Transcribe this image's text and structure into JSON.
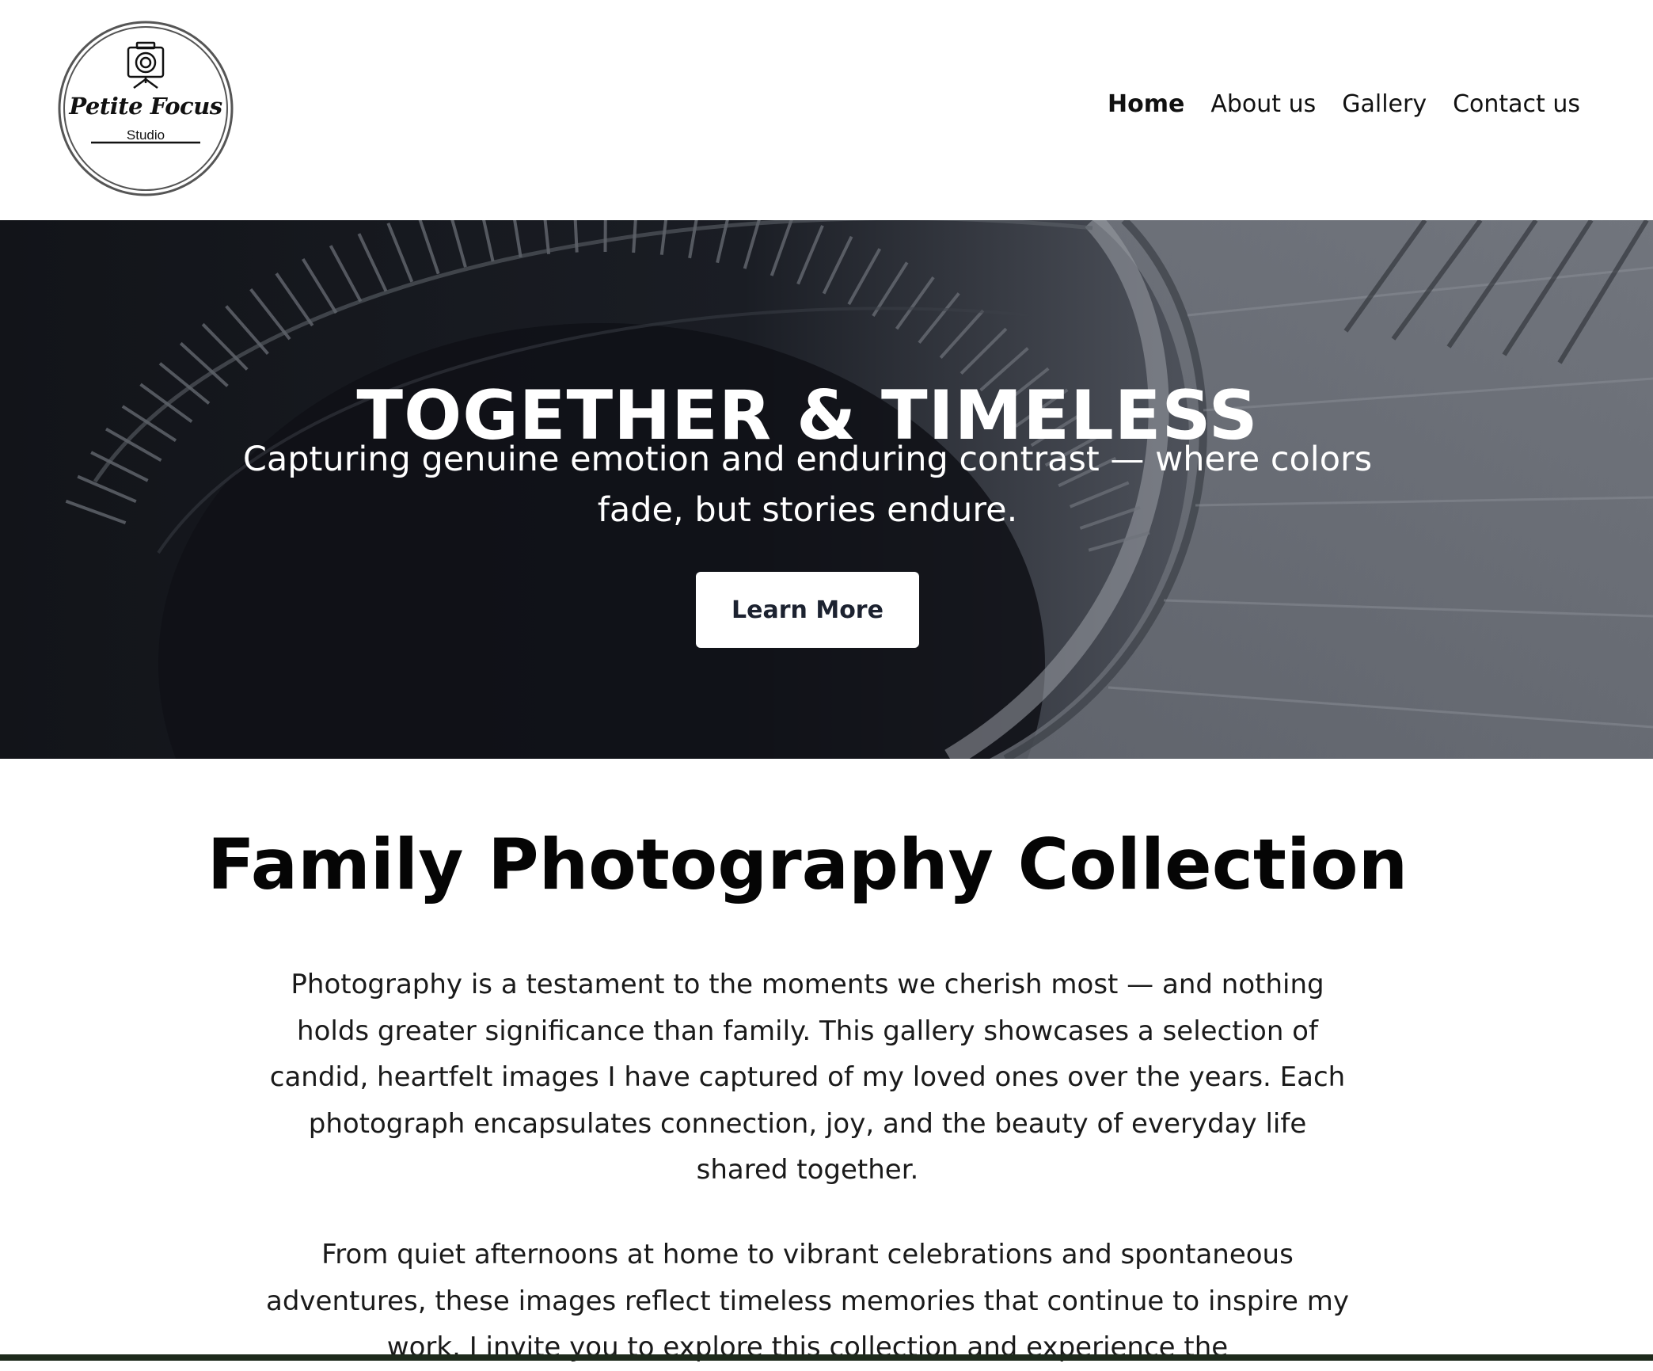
{
  "header": {
    "logo": {
      "name": "Petite Focus",
      "sub": "Studio",
      "icon": "camera-on-tripod-icon"
    },
    "nav": [
      {
        "label": "Home",
        "active": true
      },
      {
        "label": "About us",
        "active": false
      },
      {
        "label": "Gallery",
        "active": false
      },
      {
        "label": "Contact us",
        "active": false
      }
    ]
  },
  "hero": {
    "title": "TOGETHER & TIMELESS",
    "subtitle": "Capturing genuine emotion and enduring contrast — where colors fade, but stories endure.",
    "button_label": "Learn More",
    "background": "black-and-white-spiral-staircase-photo"
  },
  "main": {
    "title": "Family Photography Collection",
    "paragraphs": [
      "Photography is a testament to the moments we cherish most — and nothing holds greater significance than family. This gallery showcases a selection of candid, heartfelt images I have captured of my loved ones over the years. Each photograph encapsulates connection, joy, and the beauty of everyday life shared together.",
      "From quiet afternoons at home to vibrant celebrations and spontaneous adventures, these images reflect timeless memories that continue to inspire my work. I invite you to explore this collection and experience the"
    ]
  },
  "colors": {
    "text": "#111111",
    "button_text": "#1c2230",
    "hero_dark": "#16191f",
    "hero_light": "#8a8e96"
  }
}
